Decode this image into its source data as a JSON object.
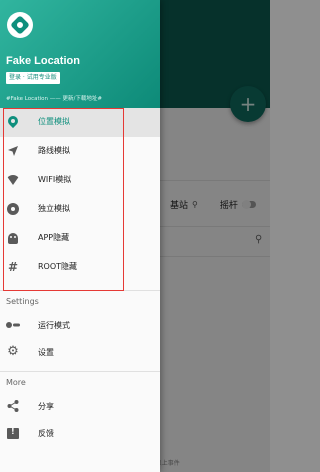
{
  "background": {
    "fab_label": "+",
    "row_label_1": "基站",
    "row_label_2": "摇杆",
    "footer_text": "...以上事件"
  },
  "drawer": {
    "app_name": "Fake Location",
    "login_badge": "登录 · 试用专业版",
    "hashtag_line": "#Fake Location —— 更新/下载地址#",
    "menu": [
      {
        "label": "位置模拟",
        "icon": "location-pin-icon",
        "active": true
      },
      {
        "label": "路线模拟",
        "icon": "navigation-arrow-icon"
      },
      {
        "label": "WIFI模拟",
        "icon": "wifi-icon"
      },
      {
        "label": "独立模拟",
        "icon": "disc-icon"
      },
      {
        "label": "APP隐藏",
        "icon": "android-icon"
      },
      {
        "label": "ROOT隐藏",
        "icon": "hash-icon"
      }
    ],
    "settings_title": "Settings",
    "settings_items": [
      {
        "label": "运行模式",
        "icon": "toggle-icon"
      },
      {
        "label": "设置",
        "icon": "gear-icon"
      }
    ],
    "more_title": "More",
    "more_items": [
      {
        "label": "分享",
        "icon": "share-icon"
      },
      {
        "label": "反馈",
        "icon": "feedback-icon"
      }
    ]
  },
  "colors": {
    "accent": "#0f8f7d",
    "header_start": "#31b59f",
    "header_end": "#0d8a78",
    "highlight_border": "#e53935"
  }
}
